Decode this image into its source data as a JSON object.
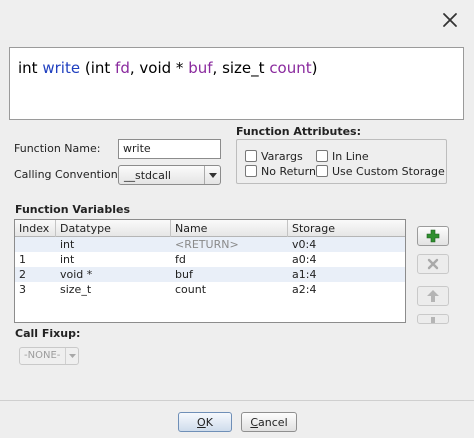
{
  "signature": {
    "return_type": "int",
    "name": "write",
    "open": "(",
    "params": [
      {
        "type": "int",
        "name": "fd"
      },
      {
        "type": "void *",
        "name": "buf"
      },
      {
        "type": "size_t",
        "name": "count"
      }
    ],
    "close": ")"
  },
  "form": {
    "function_name_label": "Function Name:",
    "function_name_value": "write",
    "calling_convention_label": "Calling Convention",
    "calling_convention_value": "__stdcall"
  },
  "attributes": {
    "title": "Function Attributes:",
    "varargs": {
      "label": "Varargs",
      "checked": false
    },
    "inline": {
      "label": "In Line",
      "checked": false
    },
    "no_return": {
      "label": "No Return",
      "checked": false
    },
    "custom_storage": {
      "label": "Use Custom Storage",
      "checked": false
    }
  },
  "variables": {
    "title": "Function Variables",
    "columns": [
      "Index",
      "Datatype",
      "Name",
      "Storage"
    ],
    "rows": [
      {
        "index": "",
        "datatype": "int",
        "name": "<RETURN>",
        "storage": "v0:4"
      },
      {
        "index": "1",
        "datatype": "int",
        "name": "fd",
        "storage": "a0:4"
      },
      {
        "index": "2",
        "datatype": "void *",
        "name": "buf",
        "storage": "a1:4"
      },
      {
        "index": "3",
        "datatype": "size_t",
        "name": "count",
        "storage": "a2:4"
      }
    ],
    "side_buttons": [
      "plus-icon",
      "x-icon",
      "up-arrow-icon",
      "down-arrow-icon"
    ]
  },
  "call_fixup": {
    "title": "Call Fixup:",
    "value": "-NONE-"
  },
  "footer": {
    "ok_prefix": "",
    "ok_mnemonic": "O",
    "ok_rest": "K",
    "cancel_prefix": "",
    "cancel_mnemonic": "C",
    "cancel_rest": "ancel"
  },
  "colors": {
    "function_name": "#1f3fbf",
    "param_name": "#8a2a9e",
    "add_icon": "#2f8f2f",
    "row_highlight": "#e9eff8"
  }
}
